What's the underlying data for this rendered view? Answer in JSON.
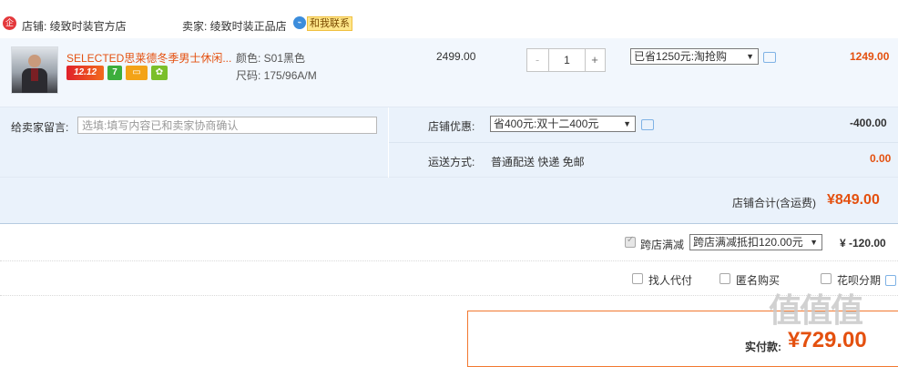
{
  "shop": {
    "store_label": "店铺: 绫致时装官方店",
    "seller_label": "卖家: 绫致时装正品店",
    "contact_label": "和我联系"
  },
  "item": {
    "title": "SELECTED思莱德冬季男士休闲...",
    "badges": [
      "12.12",
      "7",
      "▭",
      "✿"
    ],
    "color": "颜色: S01黑色",
    "size": "尺码: 175/96A/M",
    "unit_price": "2499.00",
    "quantity": "1",
    "qty_minus": "-",
    "qty_plus": "+",
    "discount_select": "已省1250元:淘抢购",
    "subtotal": "1249.00"
  },
  "message": {
    "label": "给卖家留言:",
    "placeholder": "选填:填写内容已和卖家协商确认"
  },
  "promo": {
    "label": "店铺优惠:",
    "select": "省400元:双十二400元",
    "amount": "-400.00"
  },
  "shipping": {
    "label": "运送方式:",
    "method": "普通配送 快递 免邮",
    "amount": "0.00"
  },
  "store_total": {
    "label": "店铺合计(含运费)",
    "amount": "¥849.00"
  },
  "cross_store": {
    "label": "跨店满减",
    "select": "跨店满减抵扣120.00元",
    "amount": "¥ -120.00"
  },
  "options": {
    "proxy_pay": "找人代付",
    "anonymous": "匿名购买",
    "huabei": "花呗分期"
  },
  "payment": {
    "label": "实付款:",
    "amount": "¥729.00"
  },
  "watermark": "值值值",
  "colors": {
    "accent": "#e4500f",
    "link": "#3c6bb4",
    "row_bg": "#eaf2fb"
  }
}
